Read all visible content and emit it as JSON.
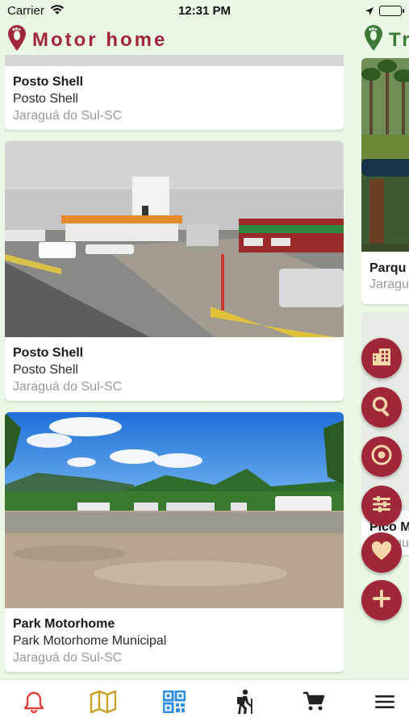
{
  "status_bar": {
    "carrier": "Carrier",
    "time": "12:31 PM"
  },
  "header": {
    "title": "Motor home",
    "next_title": "Tr",
    "brand_color": "#a0263a",
    "next_color": "#3d7a3a"
  },
  "cards": [
    {
      "name": "Posto Shell",
      "subtitle": "Posto Shell",
      "city": "Jaraguá do Sul-SC"
    },
    {
      "name": "Posto Shell",
      "subtitle": "Posto Shell",
      "city": "Jaraguá do Sul-SC",
      "photo": "gas-station-photo"
    },
    {
      "name": "Park Motorhome",
      "subtitle": "Park Motorhome Municipal",
      "city": "Jaraguá do Sul-SC",
      "photo": "park-gravel-lot-photo"
    }
  ],
  "right_column": [
    {
      "name": "Parqu",
      "city": "Jaragu"
    },
    {
      "name": "Pico M",
      "city": "Jaragu"
    }
  ],
  "fabs": [
    {
      "icon": "city-icon"
    },
    {
      "icon": "search-icon"
    },
    {
      "icon": "target-icon"
    },
    {
      "icon": "filter-icon"
    },
    {
      "icon": "heart-icon"
    },
    {
      "icon": "plus-icon"
    }
  ],
  "bottom_nav": [
    {
      "icon": "bell-icon",
      "color": "#e0403a"
    },
    {
      "icon": "map-icon",
      "color": "#c8a025"
    },
    {
      "icon": "qr-code-icon",
      "color": "#2f8fe0"
    },
    {
      "icon": "hiker-icon",
      "color": "#222222"
    },
    {
      "icon": "cart-icon",
      "color": "#222222"
    },
    {
      "icon": "menu-icon",
      "color": "#222222"
    }
  ]
}
